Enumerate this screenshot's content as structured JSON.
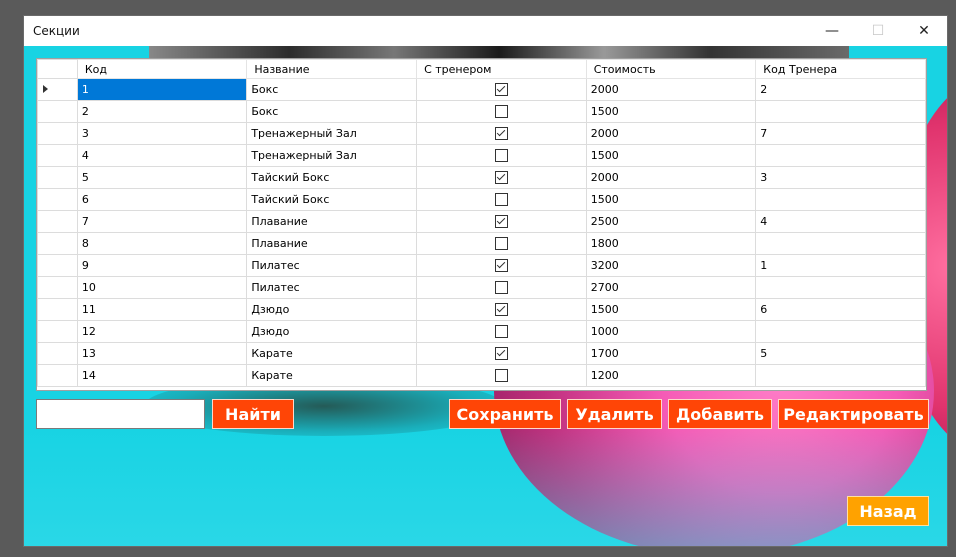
{
  "window": {
    "title": "Секции",
    "minimize": "—",
    "maximize": "☐",
    "close": "✕"
  },
  "grid": {
    "headers": [
      "Код",
      "Название",
      "С тренером",
      "Стоимость",
      "Код Тренера"
    ],
    "rows": [
      {
        "code": "1",
        "name": "Бокс",
        "trainer": true,
        "cost": "2000",
        "trainer_code": "2"
      },
      {
        "code": "2",
        "name": "Бокс",
        "trainer": false,
        "cost": "1500",
        "trainer_code": ""
      },
      {
        "code": "3",
        "name": "Тренажерный Зал",
        "trainer": true,
        "cost": "2000",
        "trainer_code": "7"
      },
      {
        "code": "4",
        "name": "Тренажерный Зал",
        "trainer": false,
        "cost": "1500",
        "trainer_code": ""
      },
      {
        "code": "5",
        "name": "Тайский Бокс",
        "trainer": true,
        "cost": "2000",
        "trainer_code": "3"
      },
      {
        "code": "6",
        "name": "Тайский Бокс",
        "trainer": false,
        "cost": "1500",
        "trainer_code": ""
      },
      {
        "code": "7",
        "name": "Плавание",
        "trainer": true,
        "cost": "2500",
        "trainer_code": "4"
      },
      {
        "code": "8",
        "name": "Плавание",
        "trainer": false,
        "cost": "1800",
        "trainer_code": ""
      },
      {
        "code": "9",
        "name": "Пилатес",
        "trainer": true,
        "cost": "3200",
        "trainer_code": "1"
      },
      {
        "code": "10",
        "name": "Пилатес",
        "trainer": false,
        "cost": "2700",
        "trainer_code": ""
      },
      {
        "code": "11",
        "name": "Дзюдо",
        "trainer": true,
        "cost": "1500",
        "trainer_code": "6"
      },
      {
        "code": "12",
        "name": "Дзюдо",
        "trainer": false,
        "cost": "1000",
        "trainer_code": ""
      },
      {
        "code": "13",
        "name": "Карате",
        "trainer": true,
        "cost": "1700",
        "trainer_code": "5"
      },
      {
        "code": "14",
        "name": "Карате",
        "trainer": false,
        "cost": "1200",
        "trainer_code": ""
      }
    ],
    "selected_row": 0
  },
  "search": {
    "value": "",
    "button": "Найти"
  },
  "actions": {
    "save": "Сохранить",
    "delete": "Удалить",
    "add": "Добавить",
    "edit": "Редактировать"
  },
  "nav": {
    "back": "Назад"
  },
  "colors": {
    "action_button": "#ff4506",
    "back_button": "#ffa200",
    "background": "#18d3e3",
    "selection": "#0078d7"
  }
}
